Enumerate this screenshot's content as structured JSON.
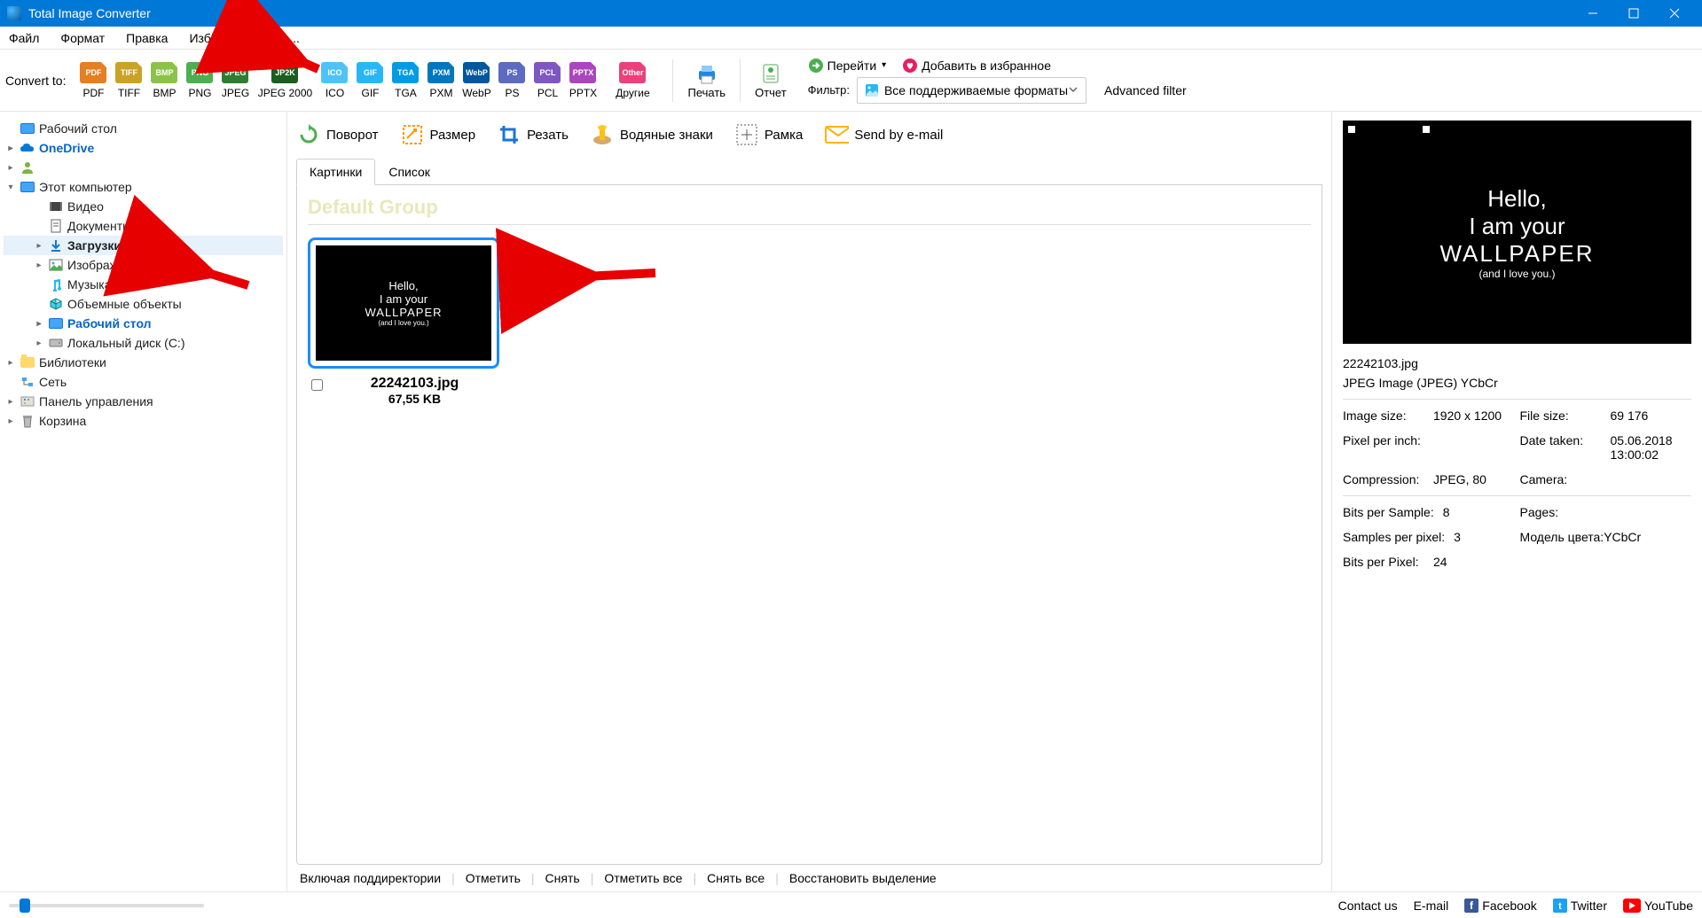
{
  "title": "Total Image Converter",
  "menu": [
    "Файл",
    "Формат",
    "Правка",
    "Избранное",
    "По..."
  ],
  "toolbar": {
    "convert_label": "Convert to:",
    "formats": [
      {
        "label": "PDF",
        "color": "#e67e22"
      },
      {
        "label": "TIFF",
        "color": "#c9a227"
      },
      {
        "label": "BMP",
        "color": "#8bc34a"
      },
      {
        "label": "PNG",
        "color": "#4caf50"
      },
      {
        "label": "JPEG",
        "color": "#2e7d32"
      },
      {
        "label": "JPEG 2000",
        "short": "JP2K",
        "color": "#1b5e20",
        "wide": true
      },
      {
        "label": "ICO",
        "color": "#4fc3f7"
      },
      {
        "label": "GIF",
        "color": "#29b6f6"
      },
      {
        "label": "TGA",
        "color": "#039be5"
      },
      {
        "label": "PXM",
        "color": "#0277bd"
      },
      {
        "label": "WebP",
        "color": "#01579b"
      },
      {
        "label": "PS",
        "color": "#5c6bc0"
      },
      {
        "label": "PCL",
        "color": "#7e57c2"
      },
      {
        "label": "PPTX",
        "color": "#ab47bc"
      },
      {
        "label": "Другие",
        "short": "Other",
        "color": "#ec407a",
        "wide": true
      }
    ],
    "print": "Печать",
    "report": "Отчет",
    "goto": "Перейти",
    "favorite": "Добавить в избранное",
    "filter_label": "Фильтр:",
    "filter_value": "Все поддерживаемые форматы",
    "advanced_filter": "Advanced filter"
  },
  "tree": [
    {
      "label": "Рабочий стол",
      "indent": 0,
      "icon": "monitor",
      "exp": "",
      "plain": true
    },
    {
      "label": "OneDrive",
      "indent": 0,
      "icon": "cloud",
      "exp": "▸",
      "bold": true
    },
    {
      "label": "",
      "indent": 0,
      "icon": "user",
      "exp": "▸",
      "plain": true
    },
    {
      "label": "Этот компьютер",
      "indent": 0,
      "icon": "monitor",
      "exp": "▾",
      "plain": true
    },
    {
      "label": "Видео",
      "indent": 2,
      "icon": "video",
      "exp": "",
      "plain": true
    },
    {
      "label": "Документы",
      "indent": 2,
      "icon": "doc",
      "exp": "",
      "plain": true
    },
    {
      "label": "Загрузки",
      "indent": 2,
      "icon": "download",
      "exp": "▸",
      "plain": true,
      "selected": true,
      "boldText": true
    },
    {
      "label": "Изображения",
      "indent": 2,
      "icon": "image",
      "exp": "▸",
      "plain": true
    },
    {
      "label": "Музыка",
      "indent": 2,
      "icon": "music",
      "exp": "",
      "plain": true
    },
    {
      "label": "Объемные объекты",
      "indent": 2,
      "icon": "3d",
      "exp": "",
      "plain": true
    },
    {
      "label": "Рабочий стол",
      "indent": 2,
      "icon": "monitor",
      "exp": "▸",
      "bold": true
    },
    {
      "label": "Локальный диск (C:)",
      "indent": 2,
      "icon": "disk",
      "exp": "▸",
      "plain": true
    },
    {
      "label": "Библиотеки",
      "indent": 0,
      "icon": "folder",
      "exp": "▸",
      "plain": true
    },
    {
      "label": "Сеть",
      "indent": 0,
      "icon": "network",
      "exp": "",
      "plain": true
    },
    {
      "label": "Панель управления",
      "indent": 0,
      "icon": "control",
      "exp": "▸",
      "plain": true
    },
    {
      "label": "Корзина",
      "indent": 0,
      "icon": "bin",
      "exp": "▸",
      "plain": true
    }
  ],
  "actions": [
    {
      "label": "Поворот",
      "icon": "rotate"
    },
    {
      "label": "Размер",
      "icon": "resize"
    },
    {
      "label": "Резать",
      "icon": "crop"
    },
    {
      "label": "Водяные знаки",
      "icon": "watermark"
    },
    {
      "label": "Рамка",
      "icon": "frame"
    },
    {
      "label": "Send by e-mail",
      "icon": "mail"
    }
  ],
  "tabs": {
    "pictures": "Картинки",
    "list": "Список"
  },
  "group_title": "Default Group",
  "thumb": {
    "lines": [
      "Hello,",
      "I am your",
      "WALLPAPER",
      "(and I love you.)"
    ],
    "filename": "22242103.jpg",
    "filesize": "67,55 KB"
  },
  "center_footer": [
    "Включая поддиректории",
    "Отметить",
    "Снять",
    "Отметить все",
    "Снять все",
    "Восстановить выделение"
  ],
  "preview": {
    "filename": "22242103.jpg",
    "type": "JPEG Image (JPEG) YCbCr",
    "props": [
      [
        {
          "k": "Image size:",
          "v": "1920 x 1200"
        },
        {
          "k": "File size:",
          "v": "69 176"
        }
      ],
      [
        {
          "k": "Pixel per inch:",
          "v": ""
        },
        {
          "k": "Date taken:",
          "v": "05.06.2018 13:00:02"
        }
      ],
      [
        {
          "k": "Compression:",
          "v": "JPEG, 80"
        },
        {
          "k": "Camera:",
          "v": ""
        }
      ]
    ],
    "props2": [
      [
        {
          "k": "Bits per Sample:",
          "v": "8"
        },
        {
          "k": "Pages:",
          "v": ""
        }
      ],
      [
        {
          "k": "Samples per pixel:",
          "v": "3"
        },
        {
          "k": "Модель цвета:",
          "v": "YCbCr",
          "tight": true
        }
      ],
      [
        {
          "k": "Bits per Pixel:",
          "v": "24"
        },
        {
          "k": "",
          "v": ""
        }
      ]
    ]
  },
  "statusbar": {
    "contact": "Contact us",
    "email": "E-mail",
    "facebook": "Facebook",
    "twitter": "Twitter",
    "youtube": "YouTube"
  }
}
